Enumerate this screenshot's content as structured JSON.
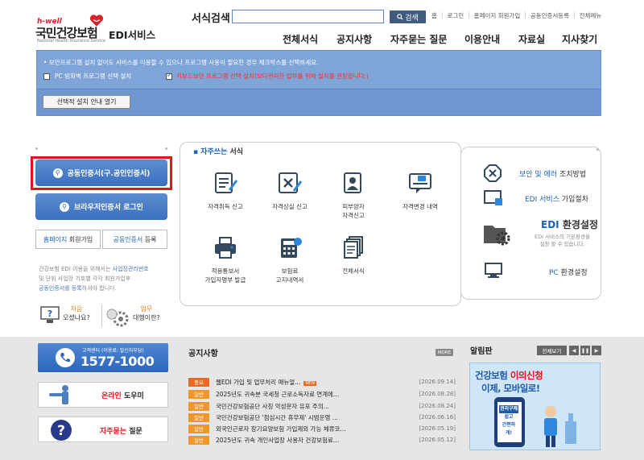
{
  "logo": {
    "hwell": "h-well",
    "name": "국민건강보험",
    "sub": "National Health Insurance Service",
    "service": "EDI서비스"
  },
  "search": {
    "label": "서식검색",
    "placeholder": "",
    "button": "검색"
  },
  "toplinks": [
    "홈",
    "로그인",
    "홈페이지 회원가입",
    "공동인증서등록",
    "전체메뉴"
  ],
  "gnb": [
    "전체서식",
    "공지사항",
    "자주묻는 질문",
    "이용안내",
    "자료실",
    "지사찾기"
  ],
  "notice": {
    "text": "• 보안프로그램 설치 없이도 서비스를 이용할 수 있으나 프로그램 사용이 필요한 경우 체크박스를 선택하세요.",
    "opt1": "PC 방화벽 프로그램 선택 설치",
    "opt2_a": "키보드보안 프로그램 선택 설치",
    "opt2_b": "(보다편리한 업무를 위해 설치를 권장합니다.)",
    "opt1_checked": false,
    "opt2_checked": true,
    "install_button": "선택적 설치 안내 열기"
  },
  "login": {
    "cert_button": "공동인증서(구.공인인증서)",
    "browser_cert_button": "브라우저인증서 로그인",
    "join_a": "홈페이지",
    "join_b": "회원가입",
    "register_a": "공동인증서",
    "register_b": "등록",
    "desc_1": "건강보험 EDI 이용을 위해서는 ",
    "desc_2": "사업장관리번호",
    "desc_3": "및 단위 사업장 기호별 각각 회원가입후",
    "desc_4": "공동인증서를 등록",
    "desc_5": "하셔야 합니다.",
    "first_a": "처음",
    "first_b": "오셨나요?",
    "proxy_a": "업무",
    "proxy_b": "대행이란?"
  },
  "favorites": {
    "title_a": "자주쓰는",
    "title_b": "서식",
    "items": [
      {
        "label_1": "자격취득 신고",
        "label_2": "",
        "icon": "form-acquire-icon"
      },
      {
        "label_1": "자격상실 신고",
        "label_2": "",
        "icon": "form-loss-icon"
      },
      {
        "label_1": "피부양자",
        "label_2": "자격신고",
        "icon": "dependent-icon"
      },
      {
        "label_1": "자격변경 내역",
        "label_2": "",
        "icon": "change-history-icon"
      },
      {
        "label_1": "적용통보서",
        "label_2": "가입자명부 발급",
        "icon": "printer-icon"
      },
      {
        "label_1": "보험료",
        "label_2": "고지내역서",
        "icon": "calculator-icon"
      },
      {
        "label_1": "전체서식",
        "label_2": "",
        "icon": "all-forms-icon"
      }
    ]
  },
  "right_panel": {
    "security_a": "보안 및 에러",
    "security_b": "조치방법",
    "edi_a": "EDI 서비스",
    "edi_b": "가입절차",
    "env_a": "EDI",
    "env_b": "환경설정",
    "env_desc_1": "EDI 서비스의 기본환경을",
    "env_desc_2": "설정 할 수 있습니다.",
    "pc_a": "PC",
    "pc_b": "환경설정"
  },
  "callcenter": {
    "sub": "고객센터 (이용료: 발신자부담)",
    "number": "1577-1000"
  },
  "online_help": {
    "a": "온라인",
    "b": "도우미"
  },
  "faq": {
    "a": "자주묻는",
    "b": "질문"
  },
  "news": {
    "title": "공지사항",
    "more": "MORE",
    "items": [
      {
        "tag": "중요",
        "text": "웹EDI 가입 및 업무처리 매뉴얼...",
        "date": "[2026.09.14]",
        "new": "NEW"
      },
      {
        "tag": "일반",
        "text": "2025년도 귀속분 국세청 근로소득자료 연계에...",
        "date": "[2026.08.28]",
        "new": ""
      },
      {
        "tag": "일반",
        "text": "국민건강보험공단 사칭 악성문자 유포 주의...",
        "date": "[2026.08.24]",
        "new": ""
      },
      {
        "tag": "일반",
        "text": "국민건강보험공단 '점심시간 휴무제' 시범운영 ...",
        "date": "[2026.06.16]",
        "new": ""
      },
      {
        "tag": "일반",
        "text": "외국인근로자 장기요양보험 가입제외 가능 체류코...",
        "date": "[2026.05.19]",
        "new": ""
      },
      {
        "tag": "일반",
        "text": "2025년도 귀속 개인사업장 사용자 건강보험료...",
        "date": "[2026.05.12]",
        "new": ""
      }
    ]
  },
  "alarm": {
    "title": "알림판",
    "view_all": "전체보기",
    "banner_1a": "건강보험",
    "banner_1b": "이의신청",
    "banner_2a": "이제,",
    "banner_2b": "모바일로!",
    "phone_text_1": "권리구제",
    "phone_text_2": "쉽고",
    "phone_text_3": "간편하게!"
  }
}
